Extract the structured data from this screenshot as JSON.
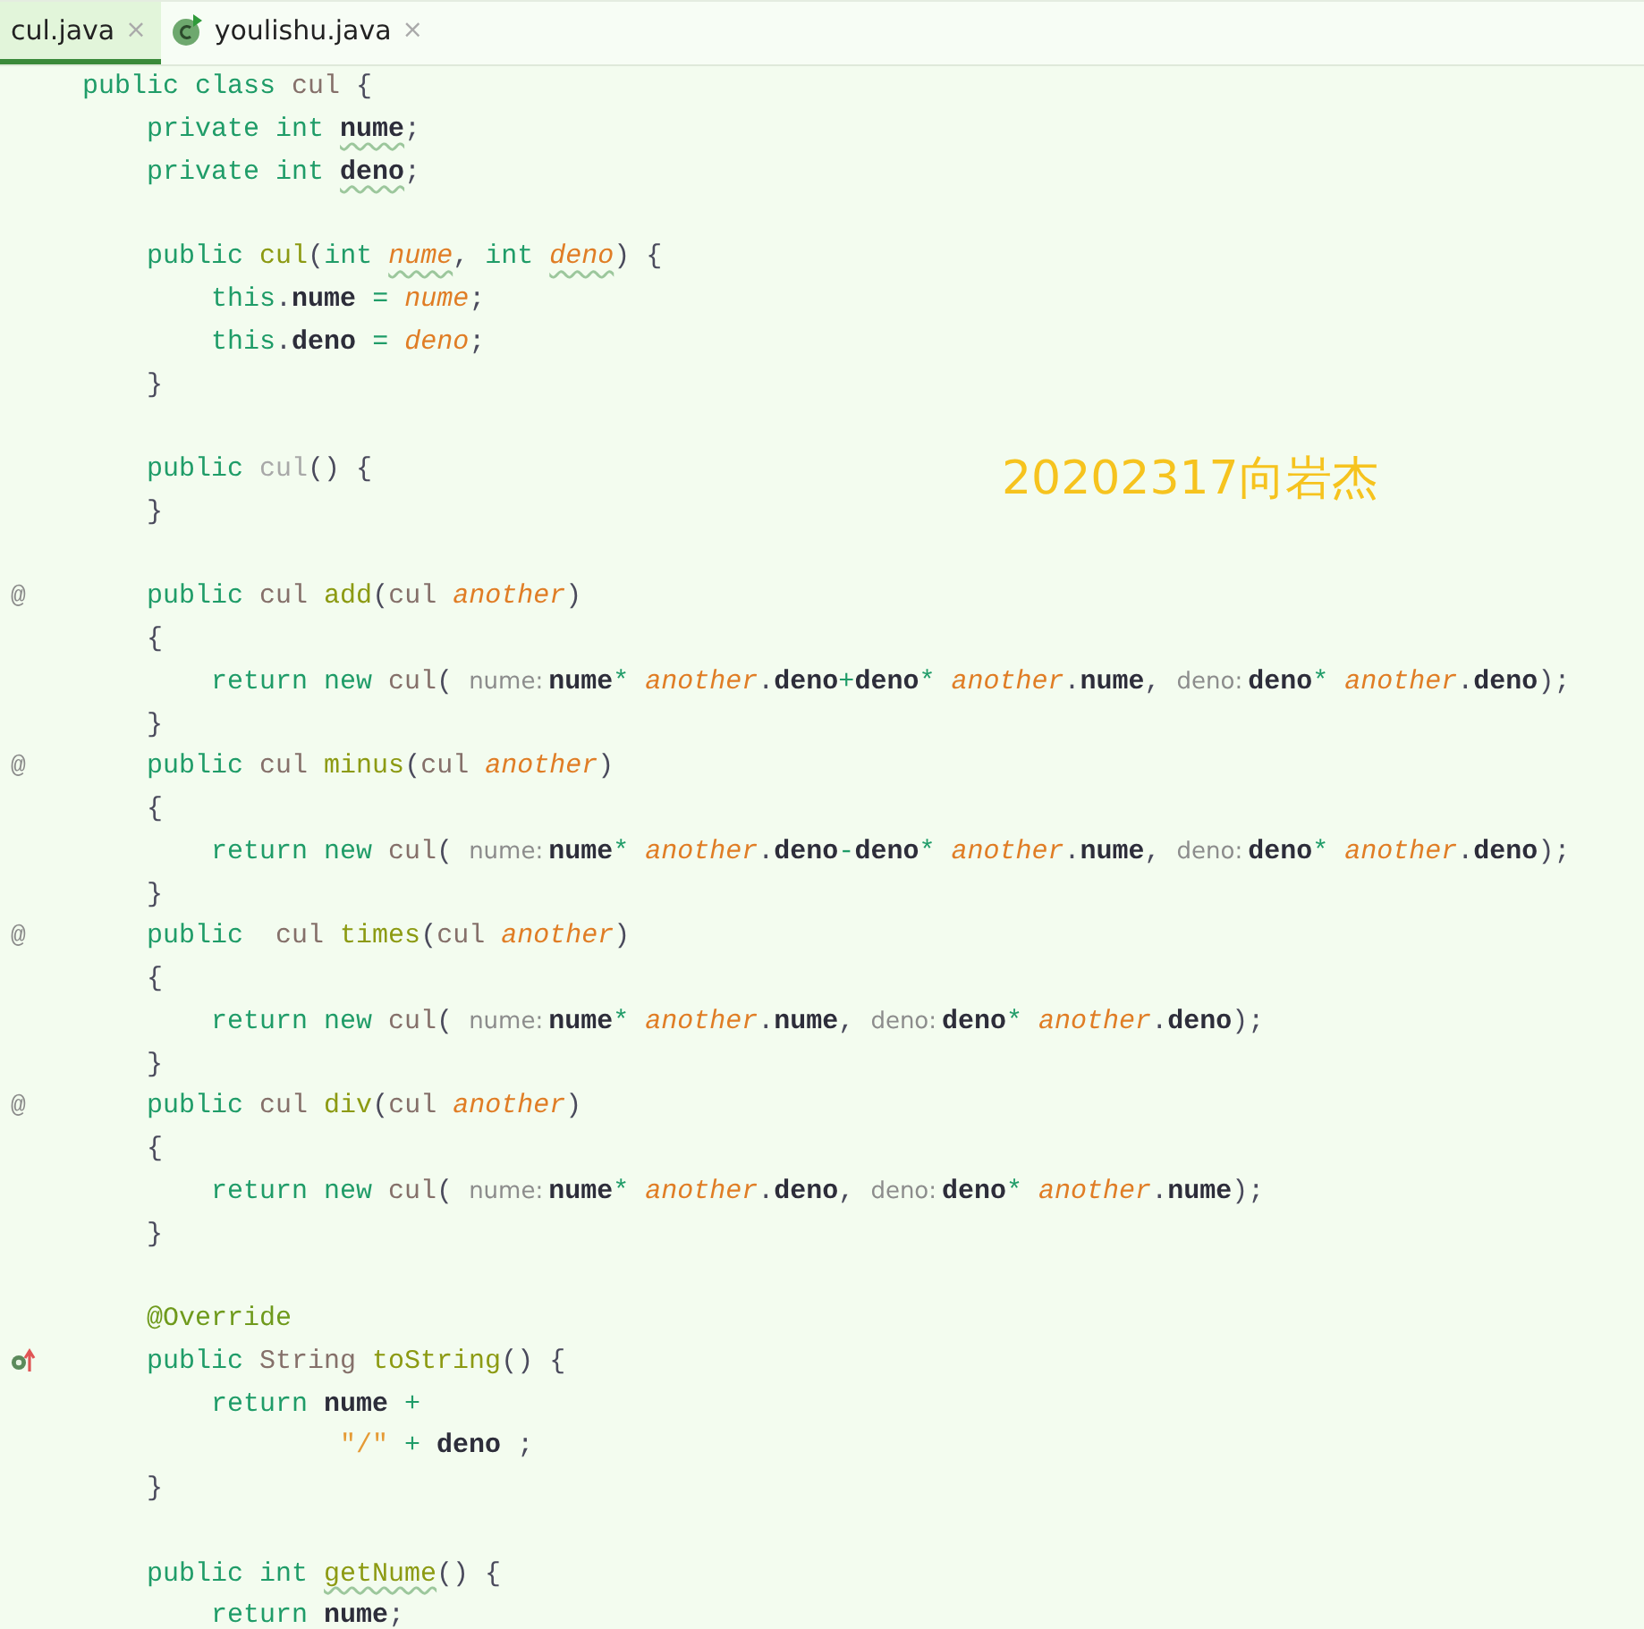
{
  "tabs": [
    {
      "label": "cul.java",
      "close": "×",
      "kind": "file",
      "selected": true
    },
    {
      "label": "youlishu.java",
      "close": "×",
      "kind": "class",
      "selected": false
    }
  ],
  "editor": {
    "lines": [
      {
        "tokens": [
          {
            "text": "public class ",
            "kind": "kw"
          },
          {
            "text": "cul",
            "kind": "type"
          },
          {
            "text": " {",
            "kind": "plain"
          }
        ]
      },
      {
        "tokens": [
          {
            "text": "    private int ",
            "kind": "kw"
          },
          {
            "text": "nume",
            "kind": "field_typo"
          },
          {
            "text": ";",
            "kind": "plain"
          }
        ]
      },
      {
        "tokens": [
          {
            "text": "    private int ",
            "kind": "kw"
          },
          {
            "text": "deno",
            "kind": "field_typo"
          },
          {
            "text": ";",
            "kind": "plain"
          }
        ]
      },
      {
        "blank_before": true,
        "tokens": [
          {
            "text": "    public ",
            "kind": "kw"
          },
          {
            "text": "cul",
            "kind": "method"
          },
          {
            "text": "(",
            "kind": "plain"
          },
          {
            "text": "int ",
            "kind": "kw"
          },
          {
            "text": "nume",
            "kind": "param_typo"
          },
          {
            "text": ", ",
            "kind": "plain"
          },
          {
            "text": "int ",
            "kind": "kw"
          },
          {
            "text": "deno",
            "kind": "param_typo"
          },
          {
            "text": ") {",
            "kind": "plain"
          }
        ]
      },
      {
        "tokens": [
          {
            "text": "        this",
            "kind": "kw"
          },
          {
            "text": ".",
            "kind": "plain"
          },
          {
            "text": "nume",
            "kind": "field"
          },
          {
            "text": " = ",
            "kind": "kw"
          },
          {
            "text": "nume",
            "kind": "param"
          },
          {
            "text": ";",
            "kind": "plain"
          }
        ]
      },
      {
        "tokens": [
          {
            "text": "        this",
            "kind": "kw"
          },
          {
            "text": ".",
            "kind": "plain"
          },
          {
            "text": "deno",
            "kind": "field"
          },
          {
            "text": " = ",
            "kind": "kw"
          },
          {
            "text": "deno",
            "kind": "param"
          },
          {
            "text": ";",
            "kind": "plain"
          }
        ]
      },
      {
        "tokens": [
          {
            "text": "    }",
            "kind": "plain"
          }
        ]
      },
      {
        "blank_before": true,
        "tokens": [
          {
            "text": "    public ",
            "kind": "kw"
          },
          {
            "text": "cul",
            "kind": "dim"
          },
          {
            "text": "() {",
            "kind": "plain"
          }
        ]
      },
      {
        "tokens": [
          {
            "text": "    }",
            "kind": "plain"
          }
        ]
      },
      {
        "blank_before": true,
        "gutter": "@",
        "tokens": [
          {
            "text": "    public ",
            "kind": "kw"
          },
          {
            "text": "cul ",
            "kind": "type"
          },
          {
            "text": "add",
            "kind": "method"
          },
          {
            "text": "(",
            "kind": "plain"
          },
          {
            "text": "cul ",
            "kind": "type"
          },
          {
            "text": "another",
            "kind": "param"
          },
          {
            "text": ")",
            "kind": "plain"
          }
        ]
      },
      {
        "tokens": [
          {
            "text": "    {",
            "kind": "plain"
          }
        ]
      },
      {
        "tokens": [
          {
            "text": "        return new ",
            "kind": "kw"
          },
          {
            "text": "cul",
            "kind": "type"
          },
          {
            "text": "( ",
            "kind": "plain"
          },
          {
            "text": "nume:",
            "kind": "hint"
          },
          {
            "text": "nume",
            "kind": "field"
          },
          {
            "text": "*",
            "kind": "kw"
          },
          {
            "text": " another",
            "kind": "param"
          },
          {
            "text": ".",
            "kind": "plain"
          },
          {
            "text": "deno",
            "kind": "field"
          },
          {
            "text": "+",
            "kind": "kw"
          },
          {
            "text": "deno",
            "kind": "field"
          },
          {
            "text": "*",
            "kind": "kw"
          },
          {
            "text": " another",
            "kind": "param"
          },
          {
            "text": ".",
            "kind": "plain"
          },
          {
            "text": "nume",
            "kind": "field"
          },
          {
            "text": ", ",
            "kind": "plain"
          },
          {
            "text": "deno:",
            "kind": "hint"
          },
          {
            "text": "deno",
            "kind": "field"
          },
          {
            "text": "*",
            "kind": "kw"
          },
          {
            "text": " another",
            "kind": "param"
          },
          {
            "text": ".",
            "kind": "plain"
          },
          {
            "text": "deno",
            "kind": "field"
          },
          {
            "text": ");",
            "kind": "plain"
          }
        ]
      },
      {
        "tokens": [
          {
            "text": "    }",
            "kind": "plain"
          }
        ]
      },
      {
        "gutter": "@",
        "tokens": [
          {
            "text": "    public ",
            "kind": "kw"
          },
          {
            "text": "cul ",
            "kind": "type"
          },
          {
            "text": "minus",
            "kind": "method"
          },
          {
            "text": "(",
            "kind": "plain"
          },
          {
            "text": "cul ",
            "kind": "type"
          },
          {
            "text": "another",
            "kind": "param"
          },
          {
            "text": ")",
            "kind": "plain"
          }
        ]
      },
      {
        "tokens": [
          {
            "text": "    {",
            "kind": "plain"
          }
        ]
      },
      {
        "tokens": [
          {
            "text": "        return new ",
            "kind": "kw"
          },
          {
            "text": "cul",
            "kind": "type"
          },
          {
            "text": "( ",
            "kind": "plain"
          },
          {
            "text": "nume:",
            "kind": "hint"
          },
          {
            "text": "nume",
            "kind": "field"
          },
          {
            "text": "*",
            "kind": "kw"
          },
          {
            "text": " another",
            "kind": "param"
          },
          {
            "text": ".",
            "kind": "plain"
          },
          {
            "text": "deno",
            "kind": "field"
          },
          {
            "text": "-",
            "kind": "kw"
          },
          {
            "text": "deno",
            "kind": "field"
          },
          {
            "text": "*",
            "kind": "kw"
          },
          {
            "text": " another",
            "kind": "param"
          },
          {
            "text": ".",
            "kind": "plain"
          },
          {
            "text": "nume",
            "kind": "field"
          },
          {
            "text": ", ",
            "kind": "plain"
          },
          {
            "text": "deno:",
            "kind": "hint"
          },
          {
            "text": "deno",
            "kind": "field"
          },
          {
            "text": "*",
            "kind": "kw"
          },
          {
            "text": " another",
            "kind": "param"
          },
          {
            "text": ".",
            "kind": "plain"
          },
          {
            "text": "deno",
            "kind": "field"
          },
          {
            "text": ");",
            "kind": "plain"
          }
        ]
      },
      {
        "tokens": [
          {
            "text": "    }",
            "kind": "plain"
          }
        ]
      },
      {
        "gutter": "@",
        "tokens": [
          {
            "text": "    public  ",
            "kind": "kw"
          },
          {
            "text": "cul ",
            "kind": "type"
          },
          {
            "text": "times",
            "kind": "method"
          },
          {
            "text": "(",
            "kind": "plain"
          },
          {
            "text": "cul ",
            "kind": "type"
          },
          {
            "text": "another",
            "kind": "param"
          },
          {
            "text": ")",
            "kind": "plain"
          }
        ]
      },
      {
        "tokens": [
          {
            "text": "    {",
            "kind": "plain"
          }
        ]
      },
      {
        "tokens": [
          {
            "text": "        return new ",
            "kind": "kw"
          },
          {
            "text": "cul",
            "kind": "type"
          },
          {
            "text": "( ",
            "kind": "plain"
          },
          {
            "text": "nume:",
            "kind": "hint"
          },
          {
            "text": "nume",
            "kind": "field"
          },
          {
            "text": "*",
            "kind": "kw"
          },
          {
            "text": " another",
            "kind": "param"
          },
          {
            "text": ".",
            "kind": "plain"
          },
          {
            "text": "nume",
            "kind": "field"
          },
          {
            "text": ", ",
            "kind": "plain"
          },
          {
            "text": "deno:",
            "kind": "hint"
          },
          {
            "text": "deno",
            "kind": "field"
          },
          {
            "text": "*",
            "kind": "kw"
          },
          {
            "text": " another",
            "kind": "param"
          },
          {
            "text": ".",
            "kind": "plain"
          },
          {
            "text": "deno",
            "kind": "field"
          },
          {
            "text": ");",
            "kind": "plain"
          }
        ]
      },
      {
        "tokens": [
          {
            "text": "    }",
            "kind": "plain"
          }
        ]
      },
      {
        "gutter": "@",
        "tokens": [
          {
            "text": "    public ",
            "kind": "kw"
          },
          {
            "text": "cul ",
            "kind": "type"
          },
          {
            "text": "div",
            "kind": "method"
          },
          {
            "text": "(",
            "kind": "plain"
          },
          {
            "text": "cul ",
            "kind": "type"
          },
          {
            "text": "another",
            "kind": "param"
          },
          {
            "text": ")",
            "kind": "plain"
          }
        ]
      },
      {
        "tokens": [
          {
            "text": "    {",
            "kind": "plain"
          }
        ]
      },
      {
        "tokens": [
          {
            "text": "        return new ",
            "kind": "kw"
          },
          {
            "text": "cul",
            "kind": "type"
          },
          {
            "text": "( ",
            "kind": "plain"
          },
          {
            "text": "nume:",
            "kind": "hint"
          },
          {
            "text": "nume",
            "kind": "field"
          },
          {
            "text": "*",
            "kind": "kw"
          },
          {
            "text": " another",
            "kind": "param"
          },
          {
            "text": ".",
            "kind": "plain"
          },
          {
            "text": "deno",
            "kind": "field"
          },
          {
            "text": ", ",
            "kind": "plain"
          },
          {
            "text": "deno:",
            "kind": "hint"
          },
          {
            "text": "deno",
            "kind": "field"
          },
          {
            "text": "*",
            "kind": "kw"
          },
          {
            "text": " another",
            "kind": "param"
          },
          {
            "text": ".",
            "kind": "plain"
          },
          {
            "text": "nume",
            "kind": "field"
          },
          {
            "text": ");",
            "kind": "plain"
          }
        ]
      },
      {
        "tokens": [
          {
            "text": "    }",
            "kind": "plain"
          }
        ]
      },
      {
        "blank_before": true,
        "tokens": [
          {
            "text": "    @Override",
            "kind": "annot"
          }
        ]
      },
      {
        "overrides": true,
        "tokens": [
          {
            "text": "    public ",
            "kind": "kw"
          },
          {
            "text": "String ",
            "kind": "type"
          },
          {
            "text": "toString",
            "kind": "method"
          },
          {
            "text": "() {",
            "kind": "plain"
          }
        ]
      },
      {
        "tokens": [
          {
            "text": "        return ",
            "kind": "kw"
          },
          {
            "text": "nume",
            "kind": "field"
          },
          {
            "text": " +",
            "kind": "kw"
          }
        ]
      },
      {
        "tokens": [
          {
            "text": "                \"/\"",
            "kind": "string"
          },
          {
            "text": " + ",
            "kind": "kw"
          },
          {
            "text": "deno",
            "kind": "field"
          },
          {
            "text": " ;",
            "kind": "plain"
          }
        ]
      },
      {
        "tokens": [
          {
            "text": "    }",
            "kind": "plain"
          }
        ]
      },
      {
        "blank_before": true,
        "tokens": [
          {
            "text": "    public int ",
            "kind": "kw"
          },
          {
            "text": "getNume",
            "kind": "method_typo"
          },
          {
            "text": "() {",
            "kind": "plain"
          }
        ]
      },
      {
        "tokens": [
          {
            "text": "        return ",
            "kind": "kw"
          },
          {
            "text": "nume",
            "kind": "field"
          },
          {
            "text": ";",
            "kind": "plain"
          }
        ]
      }
    ]
  },
  "overlay_note": "20202317向岩杰"
}
